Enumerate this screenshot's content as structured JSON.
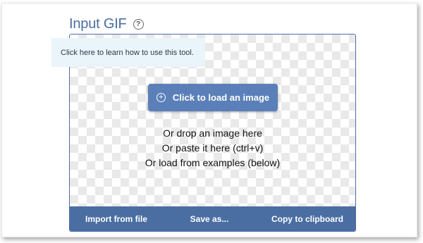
{
  "header": {
    "title": "Input GIF",
    "help_icon": "?"
  },
  "tooltip": {
    "text": "Click here to learn how to use this tool."
  },
  "dropzone": {
    "load_button_label": "Click to load an image",
    "load_button_icon": "+",
    "lines": [
      "Or drop an image here",
      "Or paste it here (ctrl+v)",
      "Or load from examples (below)"
    ]
  },
  "footer": {
    "import_label": "Import from file",
    "save_label": "Save as...",
    "copy_label": "Copy to clipboard"
  },
  "colors": {
    "accent": "#4b6ea2",
    "button": "#5b80b9",
    "tooltip_bg": "#eaf4fb"
  }
}
